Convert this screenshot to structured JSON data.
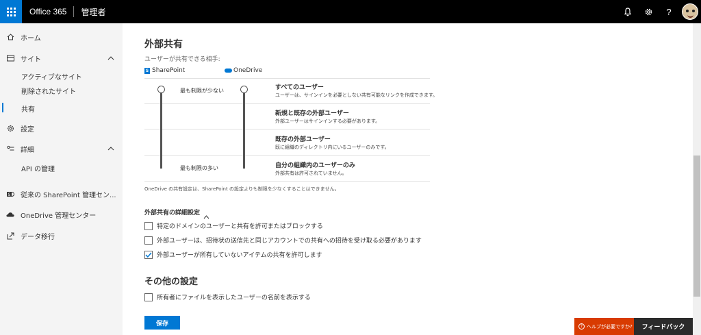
{
  "topbar": {
    "brand": "Office 365",
    "app_title": "管理者",
    "icons": [
      "waffle-icon",
      "bell-icon",
      "gear-icon",
      "help-icon",
      "avatar"
    ]
  },
  "sidebar": {
    "items": [
      {
        "label": "ホーム",
        "icon": "home-icon"
      },
      {
        "label": "サイト",
        "icon": "site-icon"
      },
      {
        "label": "設定",
        "icon": "gear-icon"
      },
      {
        "label": "詳細",
        "icon": "advanced-icon"
      },
      {
        "label": "従来の SharePoint 管理セン...",
        "icon": "sharepoint-icon"
      },
      {
        "label": "OneDrive 管理センター",
        "icon": "onedrive-icon"
      },
      {
        "label": "データ移行",
        "icon": "migration-icon"
      }
    ],
    "sites_sub": [
      "アクティブなサイト",
      "削除されたサイト",
      "共有"
    ],
    "advanced_sub": [
      "API の管理"
    ],
    "active": "共有"
  },
  "main": {
    "title": "外部共有",
    "share_label": "ユーザーが共有できる相手:",
    "sharepoint_label": "SharePoint",
    "onedrive_label": "OneDrive",
    "least_restrictive": "最も制限が少ない",
    "most_restrictive": "最も制限の多い",
    "options": [
      {
        "title": "すべてのユーザー",
        "desc": "ユーザーは、サインインを必要としない共有可能なリンクを作成できます。"
      },
      {
        "title": "新規と既存の外部ユーザー",
        "desc": "外部ユーザーはサインインする必要があります。"
      },
      {
        "title": "既存の外部ユーザー",
        "desc": "既に組織のディレクトリ内にいるユーザーのみです。"
      },
      {
        "title": "自分の組織内のユーザーのみ",
        "desc": "外部共有は許可されていません。"
      }
    ],
    "note": "OneDrive の共有設定は、SharePoint の設定よりも制限を少なくすることはできません。",
    "advanced_title": "外部共有の詳細設定",
    "advanced_options": [
      {
        "label": "特定のドメインのユーザーと共有を許可またはブロックする",
        "checked": false
      },
      {
        "label": "外部ユーザーは、招待状の送信先と同じアカウントでの共有への招待を受け取る必要があります",
        "checked": false
      },
      {
        "label": "外部ユーザーが所有していないアイテムの共有を許可します",
        "checked": true
      }
    ],
    "other_title": "その他の設定",
    "other_options": [
      {
        "label": "所有者にファイルを表示したユーザーの名前を表示する",
        "checked": false
      }
    ],
    "save_label": "保存"
  },
  "footer": {
    "help_label": "ヘルプが必要ですか?",
    "feedback_label": "フィードバック"
  },
  "colors": {
    "accent": "#0078d4",
    "topbar": "#000000",
    "help": "#d83b01",
    "feedback": "#2b2b2b"
  }
}
